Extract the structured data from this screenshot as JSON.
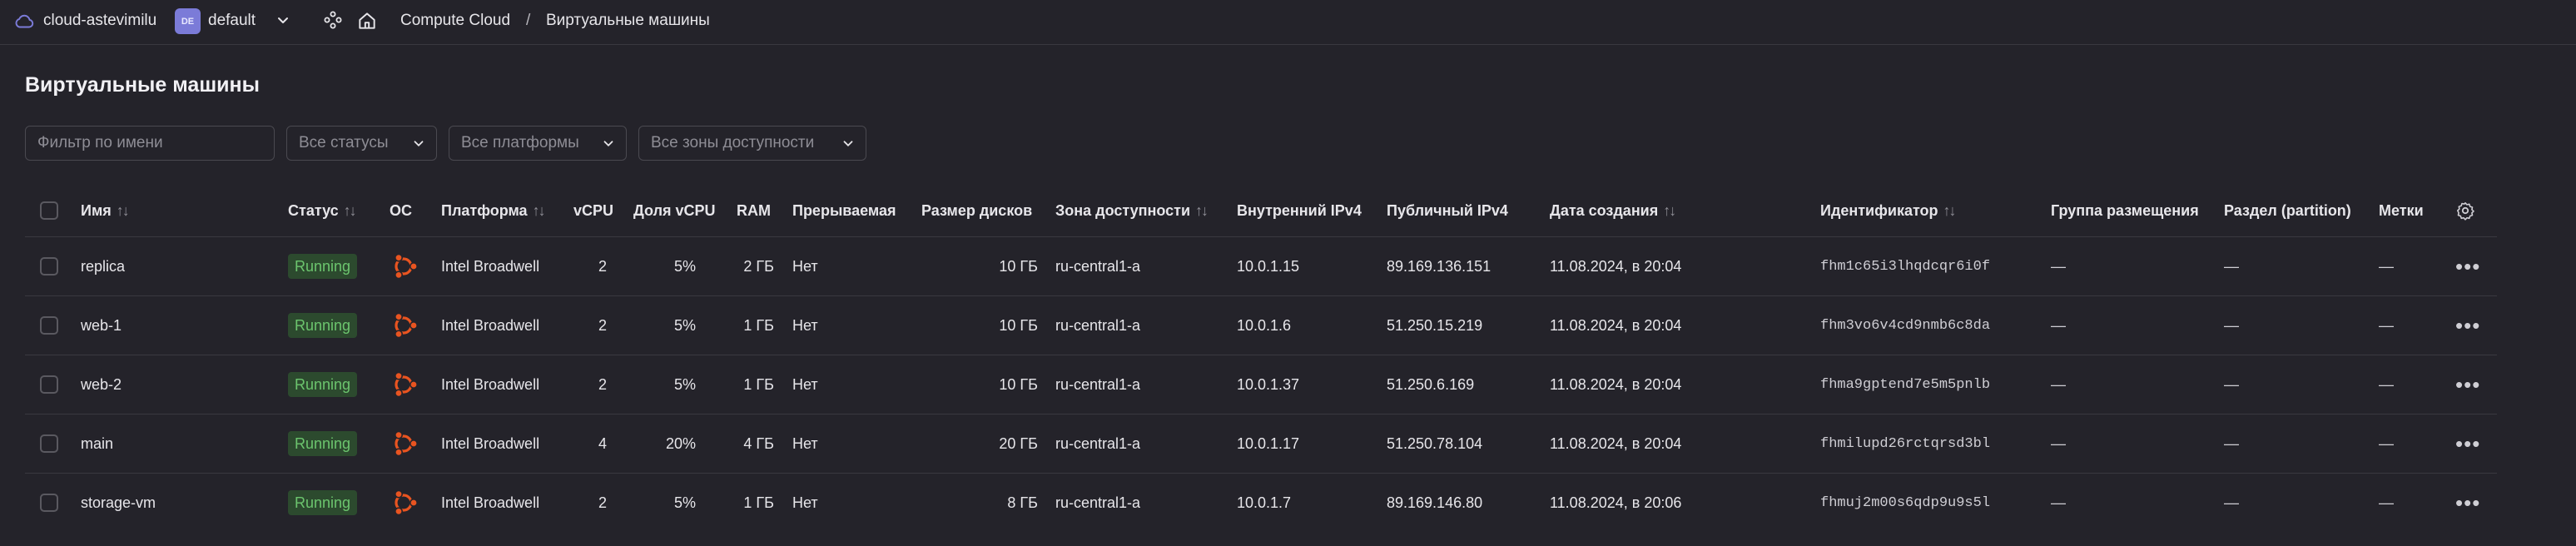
{
  "header": {
    "cloud_name": "cloud-astevimilu",
    "folder_badge": "DE",
    "folder_name": "default",
    "breadcrumb_service": "Compute Cloud",
    "breadcrumb_sep": "/",
    "breadcrumb_page": "Виртуальные машины"
  },
  "page": {
    "title": "Виртуальные машины"
  },
  "filters": {
    "name_placeholder": "Фильтр по имени",
    "status": "Все статусы",
    "platform": "Все платформы",
    "zone": "Все зоны доступности"
  },
  "columns": {
    "name": "Имя",
    "status": "Статус",
    "os": "ОС",
    "platform": "Платформа",
    "vcpu": "vCPU",
    "vcpu_share": "Доля vCPU",
    "ram": "RAM",
    "preemptible": "Прерываемая",
    "disk_size": "Размер дисков",
    "zone": "Зона доступности",
    "internal_ip": "Внутренний IPv4",
    "public_ip": "Публичный IPv4",
    "created": "Дата создания",
    "id": "Идентификатор",
    "placement_group": "Группа размещения",
    "partition": "Раздел (partition)",
    "labels": "Метки"
  },
  "sort_glyph": "↑↓",
  "rows": [
    {
      "name": "replica",
      "status": "Running",
      "platform": "Intel Broadwell",
      "vcpu": "2",
      "vcpu_share": "5%",
      "ram": "2 ГБ",
      "preemptible": "Нет",
      "disk_size": "10 ГБ",
      "zone": "ru-central1-a",
      "internal_ip": "10.0.1.15",
      "public_ip": "89.169.136.151",
      "created": "11.08.2024, в 20:04",
      "id": "fhm1c65i3lhqdcqr6i0f",
      "placement_group": "—",
      "partition": "—",
      "labels": "—"
    },
    {
      "name": "web-1",
      "status": "Running",
      "platform": "Intel Broadwell",
      "vcpu": "2",
      "vcpu_share": "5%",
      "ram": "1 ГБ",
      "preemptible": "Нет",
      "disk_size": "10 ГБ",
      "zone": "ru-central1-a",
      "internal_ip": "10.0.1.6",
      "public_ip": "51.250.15.219",
      "created": "11.08.2024, в 20:04",
      "id": "fhm3vo6v4cd9nmb6c8da",
      "placement_group": "—",
      "partition": "—",
      "labels": "—"
    },
    {
      "name": "web-2",
      "status": "Running",
      "platform": "Intel Broadwell",
      "vcpu": "2",
      "vcpu_share": "5%",
      "ram": "1 ГБ",
      "preemptible": "Нет",
      "disk_size": "10 ГБ",
      "zone": "ru-central1-a",
      "internal_ip": "10.0.1.37",
      "public_ip": "51.250.6.169",
      "created": "11.08.2024, в 20:04",
      "id": "fhma9gptend7e5m5pnlb",
      "placement_group": "—",
      "partition": "—",
      "labels": "—"
    },
    {
      "name": "main",
      "status": "Running",
      "platform": "Intel Broadwell",
      "vcpu": "4",
      "vcpu_share": "20%",
      "ram": "4 ГБ",
      "preemptible": "Нет",
      "disk_size": "20 ГБ",
      "zone": "ru-central1-a",
      "internal_ip": "10.0.1.17",
      "public_ip": "51.250.78.104",
      "created": "11.08.2024, в 20:04",
      "id": "fhmilupd26rctqrsd3bl",
      "placement_group": "—",
      "partition": "—",
      "labels": "—"
    },
    {
      "name": "storage-vm",
      "status": "Running",
      "platform": "Intel Broadwell",
      "vcpu": "2",
      "vcpu_share": "5%",
      "ram": "1 ГБ",
      "preemptible": "Нет",
      "disk_size": "8 ГБ",
      "zone": "ru-central1-a",
      "internal_ip": "10.0.1.7",
      "public_ip": "89.169.146.80",
      "created": "11.08.2024, в 20:06",
      "id": "fhmuj2m00s6qdp9u9s5l",
      "placement_group": "—",
      "partition": "—",
      "labels": "—"
    }
  ],
  "row_more": "•••",
  "icons": {
    "cloud": "cloud-icon",
    "folder_chevron": "chevron-down-icon",
    "services": "services-icon",
    "home": "home-icon",
    "os": "ubuntu-icon",
    "settings": "gear-icon",
    "more": "more-horizontal-icon"
  },
  "colors": {
    "background": "#24232a",
    "status_running_bg": "#2c4a2e",
    "status_running_text": "#6cc56e",
    "folder_badge": "#7b7bd8",
    "ubuntu": "#e95420",
    "cloud_icon": "#7b7bd8"
  }
}
